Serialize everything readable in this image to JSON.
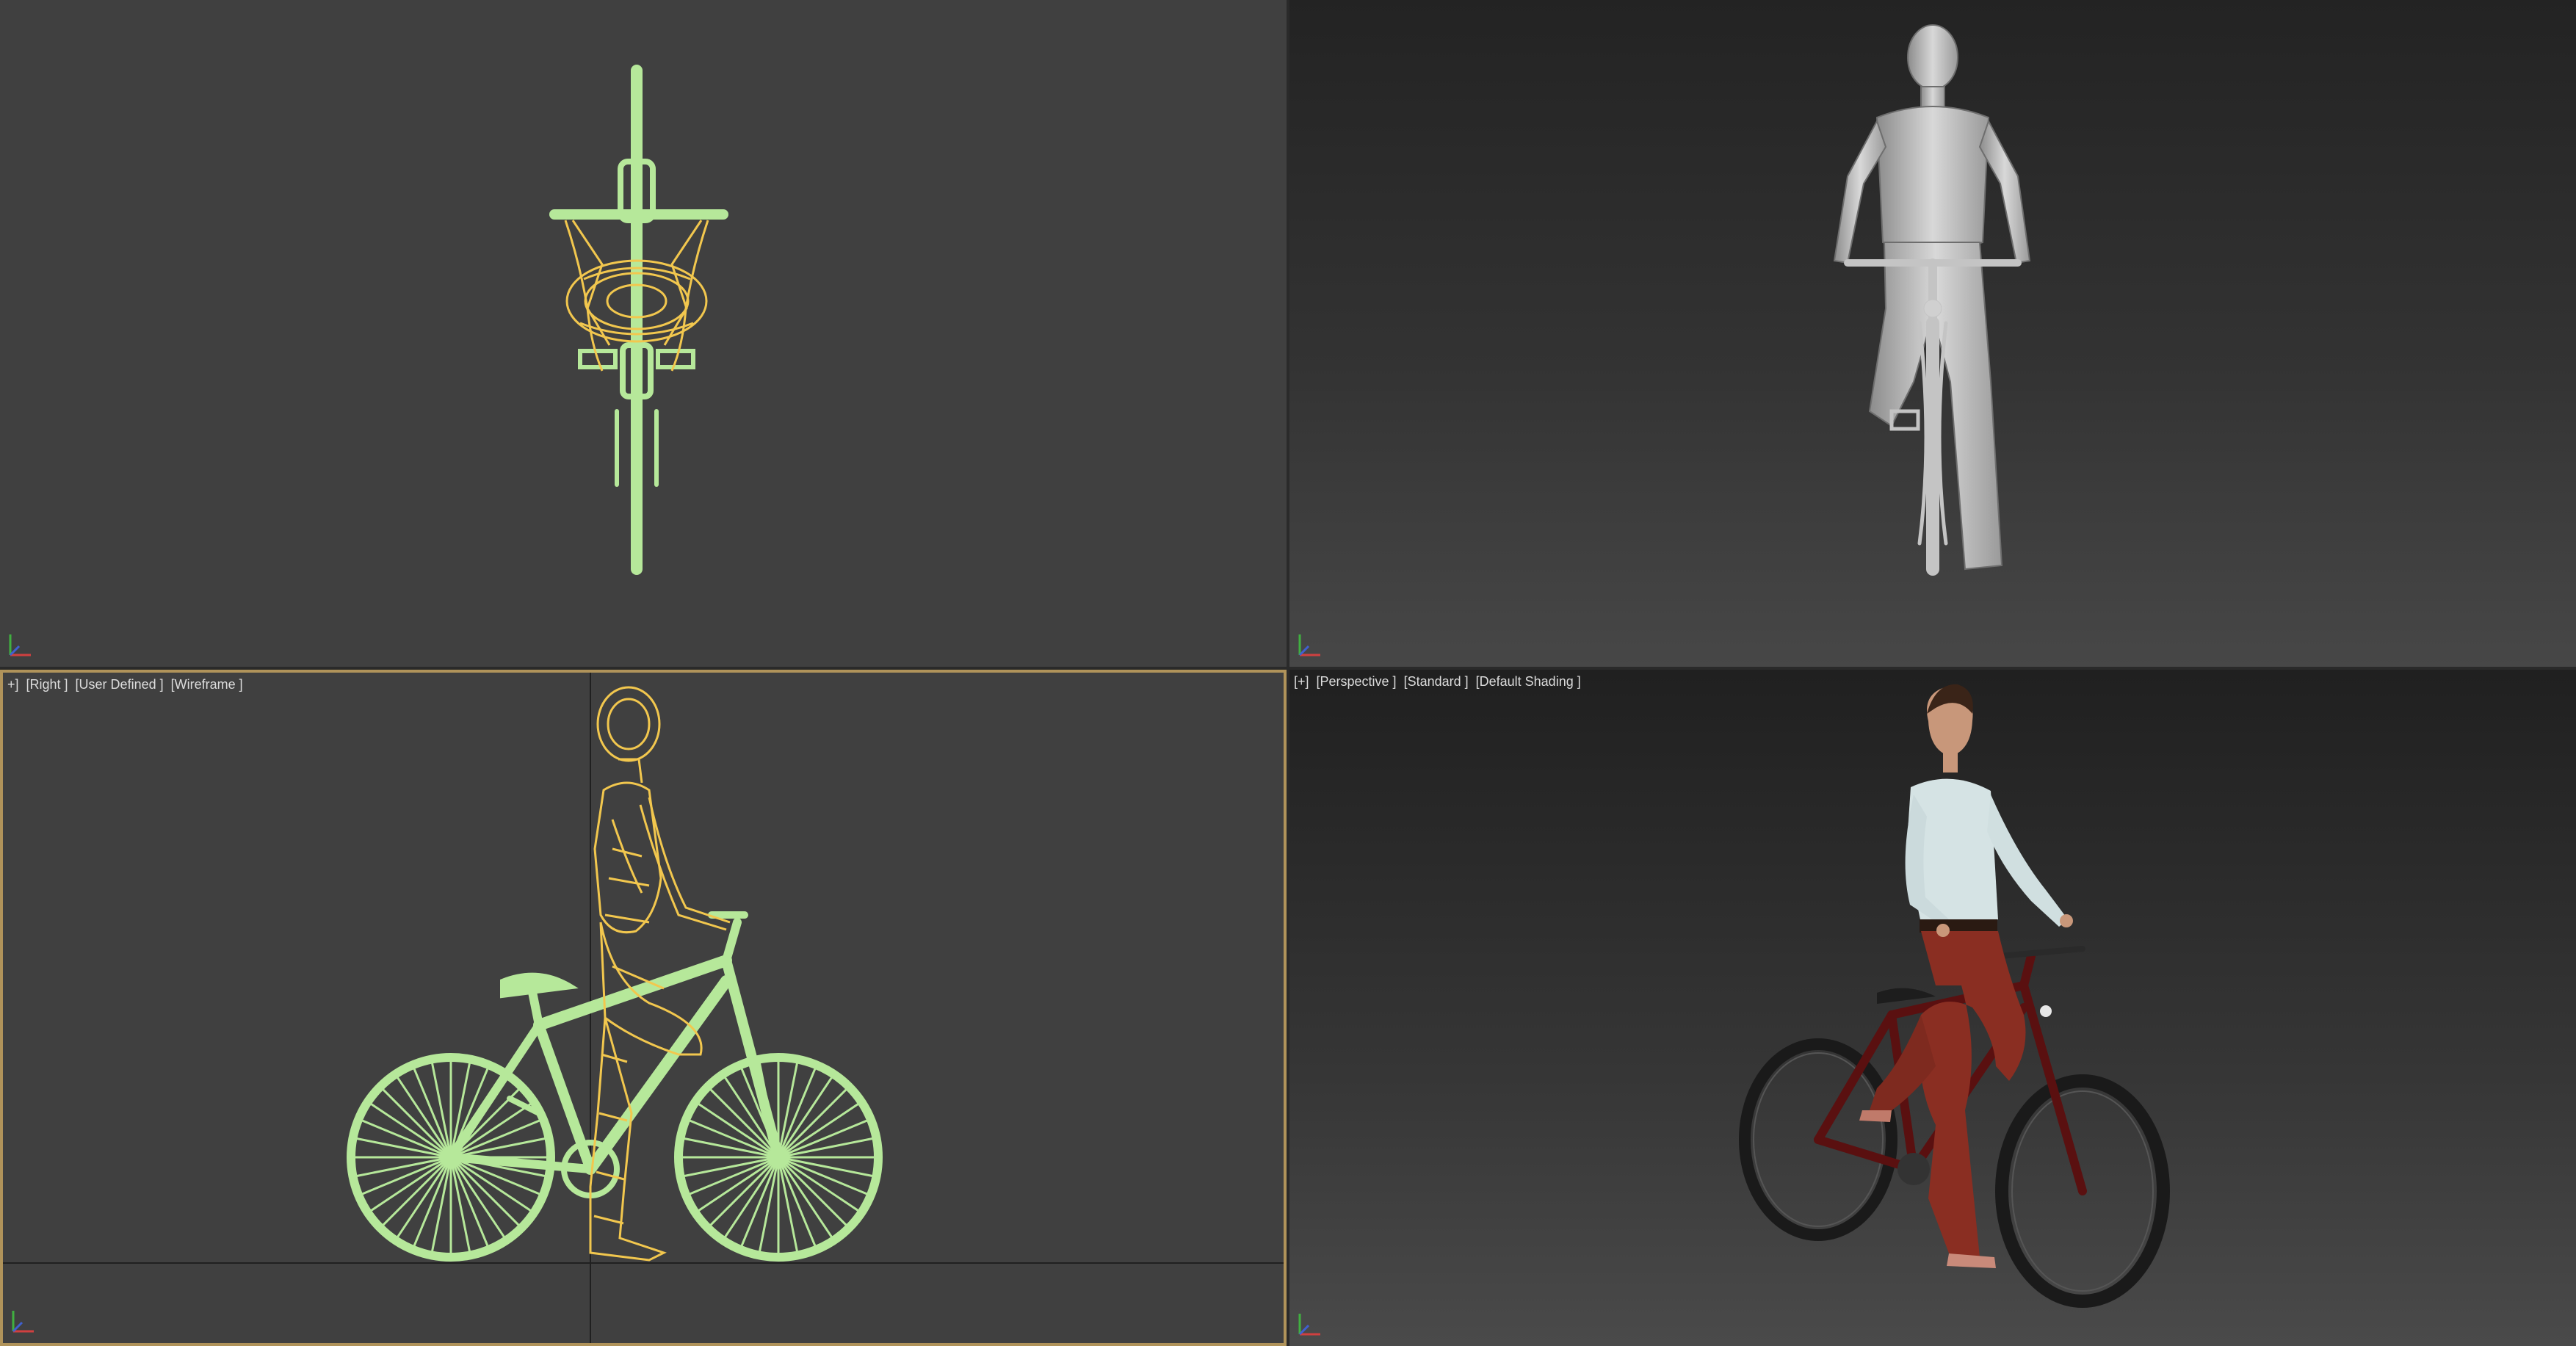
{
  "viewports": {
    "top_left": {
      "labels": []
    },
    "top_right": {
      "labels": []
    },
    "bottom_left": {
      "labels": [
        "+]",
        "[Right ]",
        "[User Defined ]",
        "[Wireframe ]"
      ]
    },
    "bottom_right": {
      "labels": [
        "[+]",
        "[Perspective ]",
        "[Standard ]",
        "[Default Shading ]"
      ]
    }
  },
  "colors": {
    "wire_bike": "#b6e89a",
    "wire_person": "#f2c74e",
    "clay": "#b8b8b8",
    "active_border": "#b0935a"
  },
  "icons": {
    "axis_gizmo": "axis-tripod-icon"
  }
}
